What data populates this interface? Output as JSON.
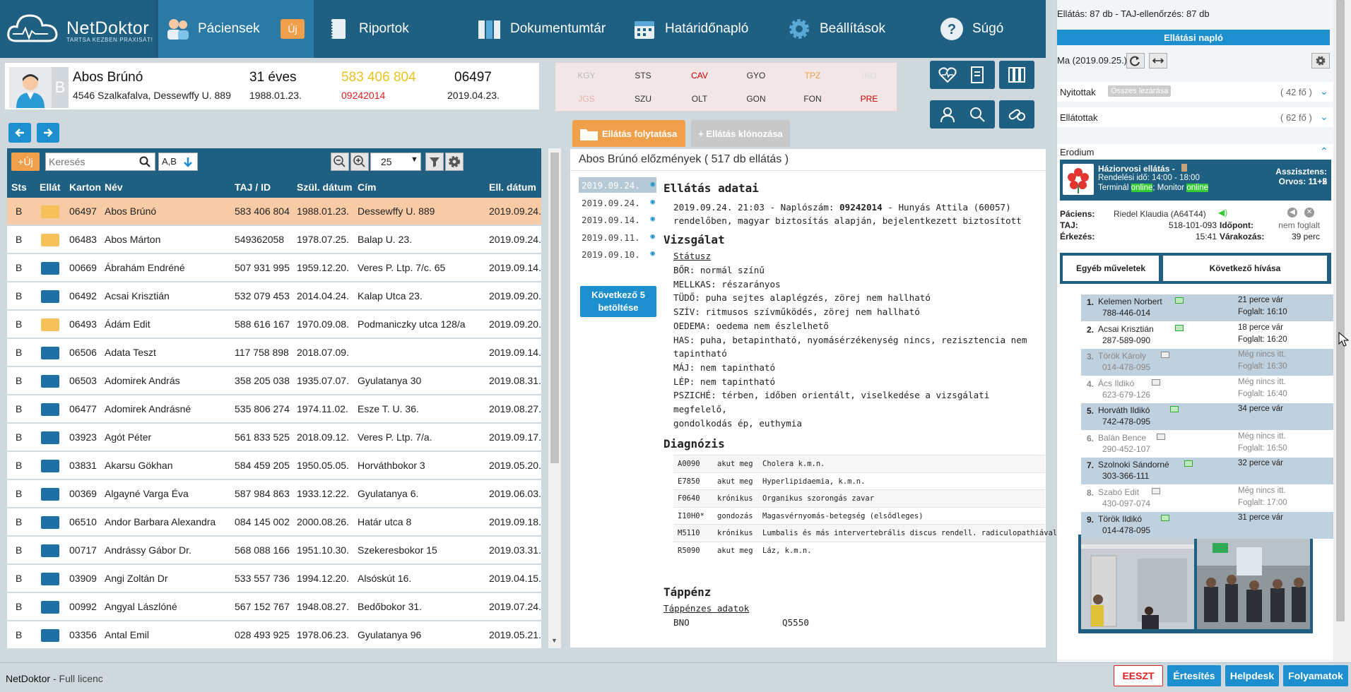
{
  "nav": {
    "logo_name": "NetDoktor",
    "logo_tagline": "TARTSA KEZBEN PRAXISÁT!",
    "patients": "Páciensek",
    "new_badge": "Új",
    "reports": "Riportok",
    "documents": "Dokumentumtár",
    "deadlines": "Határidőnapló",
    "settings": "Beállítások",
    "help": "Súgó"
  },
  "patient": {
    "name": "Abos Brúnó",
    "address": "4546 Szalkafalva, Dessewffy U. 889",
    "age": "31 éves",
    "dob": "1988.01.23.",
    "taj": "583 406 804",
    "log_no": "09242014",
    "card": "06497",
    "card_date": "2019.04.23.",
    "status": "B"
  },
  "flags": {
    "row1": [
      "KGY",
      "STS",
      "CAV",
      "GYO",
      "TPZ",
      "IND"
    ],
    "row2": [
      "JGS",
      "SZU",
      "OLT",
      "GON",
      "FON",
      "PRE"
    ],
    "colors1": [
      "#bbbbbb",
      "#333333",
      "#cc0000",
      "#333333",
      "#f0a04b",
      "#dddddd"
    ],
    "colors2": [
      "#e6b0b0",
      "#333333",
      "#333333",
      "#333333",
      "#333333",
      "#cc0000"
    ]
  },
  "list": {
    "new_btn": "+Új",
    "search_placeholder": "Keresés",
    "sort_label": "A,B",
    "page_size": "25",
    "headers": [
      "Sts",
      "Ellát",
      "Karton",
      "Név",
      "TAJ / ID",
      "Szül. dátum",
      "Cím",
      "Ell. dátum"
    ],
    "rows": [
      {
        "sts": "B",
        "folder": "open",
        "karton": "06497",
        "name": "Abos Brúnó",
        "taj": "583 406 804",
        "dob": "1988.01.23.",
        "addr": "Dessewffy U. 889",
        "date": "2019.09.24."
      },
      {
        "sts": "B",
        "folder": "open",
        "karton": "06483",
        "name": "Abos Márton",
        "taj": "549362058",
        "dob": "1978.07.25.",
        "addr": "Balap U. 23.",
        "date": "2019.09.24."
      },
      {
        "sts": "B",
        "folder": "closed",
        "karton": "00669",
        "name": "Ábrahám Endréné",
        "taj": "507 931 995",
        "dob": "1959.12.20.",
        "addr": "Veres P. Ltp. 7/c. 65",
        "date": "2019.09.14."
      },
      {
        "sts": "B",
        "folder": "closed",
        "karton": "06492",
        "name": "Acsai Krisztián",
        "taj": "532 079 453",
        "dob": "2014.04.24.",
        "addr": "Kalap Utca 23.",
        "date": "2019.09.20."
      },
      {
        "sts": "B",
        "folder": "open",
        "karton": "06493",
        "name": "Ádám Edit",
        "taj": "588 616 167",
        "dob": "1970.09.08.",
        "addr": "Podmaniczky utca 128/a",
        "date": "2019.09.20."
      },
      {
        "sts": "B",
        "folder": "closed",
        "karton": "06506",
        "name": "Adata Teszt",
        "taj": "117 758 898",
        "dob": "2018.07.09.",
        "addr": "",
        "date": "2019.09.14."
      },
      {
        "sts": "B",
        "folder": "closed",
        "karton": "06503",
        "name": "Adomirek András",
        "taj": "358 205 038",
        "dob": "1935.07.07.",
        "addr": "Gyulatanya 30",
        "date": "2019.08.31."
      },
      {
        "sts": "B",
        "folder": "closed",
        "karton": "06477",
        "name": "Adomirek Andrásné",
        "taj": "535 806 274",
        "dob": "1974.11.02.",
        "addr": "Esze T. U. 36.",
        "date": "2019.08.27."
      },
      {
        "sts": "B",
        "folder": "closed",
        "karton": "03923",
        "name": "Agót Péter",
        "taj": "561 833 525",
        "dob": "2018.09.12.",
        "addr": "Veres P. Ltp. 7/a.",
        "date": "2019.09.17."
      },
      {
        "sts": "B",
        "folder": "closed",
        "karton": "03831",
        "name": "Akarsu Gökhan",
        "taj": "584 459 205",
        "dob": "1950.05.05.",
        "addr": "Horváthbokor 3",
        "date": "2019.05.20."
      },
      {
        "sts": "B",
        "folder": "closed",
        "karton": "00369",
        "name": "Algayné Varga Éva",
        "taj": "587 984 863",
        "dob": "1933.12.22.",
        "addr": "Gyulatanya 6.",
        "date": "2019.06.03."
      },
      {
        "sts": "B",
        "folder": "closed",
        "karton": "06510",
        "name": "Andor Barbara Alexandra",
        "taj": "084 145 002",
        "dob": "2000.08.26.",
        "addr": "Határ utca 8",
        "date": "2019.09.18."
      },
      {
        "sts": "B",
        "folder": "closed",
        "karton": "00717",
        "name": "Andrássy Gábor Dr.",
        "taj": "568 088 166",
        "dob": "1951.10.30.",
        "addr": "Szekeresbokor 15",
        "date": "2019.03.31."
      },
      {
        "sts": "B",
        "folder": "closed",
        "karton": "03909",
        "name": "Angi Zoltán Dr",
        "taj": "533 557 736",
        "dob": "1994.12.20.",
        "addr": "Alsóskút 16.",
        "date": "2019.04.15."
      },
      {
        "sts": "B",
        "folder": "closed",
        "karton": "00992",
        "name": "Angyal Lászlóné",
        "taj": "567 152 767",
        "dob": "1948.08.27.",
        "addr": "Bedőbokor 31.",
        "date": "2019.07.24."
      },
      {
        "sts": "B",
        "folder": "closed",
        "karton": "03356",
        "name": "Antal Emil",
        "taj": "028 493 925",
        "dob": "1978.06.23.",
        "addr": "Gyulatanya 96",
        "date": "2019.05.21."
      }
    ]
  },
  "tabs": {
    "continue": "Ellátás folytatása",
    "clone": "+ Ellátás klónozása"
  },
  "history": {
    "title": "Abos Brúnó előzmények ( 517 db ellátás )",
    "dates": [
      "2019.09.24.",
      "2019.09.24.",
      "2019.09.14.",
      "2019.09.11.",
      "2019.09.10."
    ],
    "more_btn_1": "Következő 5",
    "more_btn_2": "betöltése"
  },
  "record": {
    "h_data": "Ellátás adatai",
    "line1_a": "2019.09.24. 21:03 - Naplószám: ",
    "line1_b": "09242014",
    "line1_c": " - Hunyás Attila (60057)",
    "line2": "rendelőben, magyar biztosítás alapján, bejelentkezett biztosított",
    "h_exam": "Vizsgálat",
    "status_link": "Státusz",
    "exam_lines": [
      "BŐR: normál színű",
      "MELLKAS: részarányos",
      "TÜDŐ: puha sejtes alaplégzés, zörej nem hallható",
      "SZÍV: ritmusos szívműködés, zörej nem hallható",
      "OEDEMA: oedema nem észlelhető",
      "HAS: puha, betapintható, nyomásérzékenység nincs, rezisztencia nem",
      "tapintható",
      "MÁJ: nem tapintható",
      "LÉP: nem tapintható",
      "PSZICHÉ: térben, időben orientált, viselkedése a vizsgálati megfelelő,",
      "gondolkodás ép, euthymia"
    ],
    "h_diag": "Diagnózis",
    "diagnoses": [
      {
        "code": "A0090",
        "type": "akut meg",
        "text": "Cholera k.m.n."
      },
      {
        "code": "E7850",
        "type": "akut meg",
        "text": "Hyperlipidaemia, k.m.n."
      },
      {
        "code": "F0640",
        "type": "krónikus",
        "text": "Organikus szorongás zavar"
      },
      {
        "code": "I10H0*",
        "type": "gondozás",
        "text": "Magasvérnyomás-betegség (elsődleges)"
      },
      {
        "code": "M5110",
        "type": "krónikus",
        "text": "Lumbalis és más intervertebrális discus rendell. radiculopathiával"
      },
      {
        "code": "R5090",
        "type": "akut meg",
        "text": "Láz, k.m.n."
      }
    ],
    "h_sick": "Táppénz",
    "sick_link": "Táppénzes adatok",
    "bno_label": "BNO",
    "bno_value": "Q5550"
  },
  "rpanel": {
    "summary": "Ellátás: 87 db - TAJ-ellenőrzés: 87 db",
    "log_btn": "Ellátási napló",
    "today": "Ma (2019.09.25.)",
    "open_label": "Nyitottak",
    "close_all": "Összes lezárása",
    "open_count": "( 42 fő )",
    "served_label": "Ellátottak",
    "served_count": "( 62 fő )",
    "erodium": "Erodium",
    "clinic_title": "Háziorvosi ellátás -",
    "hours": "Rendelési idő: 14:00 - 18:00",
    "terminal_label": "Terminál",
    "terminal_status": "online",
    "monitor_label": "; Monitor",
    "monitor_status": "online",
    "assistants": "Asszisztens: 1+2",
    "doctors": "Orvos: 11+5",
    "patient_label": "Páciens:",
    "patient_value": "Riedel Klaudia (A64T44)",
    "taj_label": "TAJ:",
    "taj_value": "518-101-093",
    "appt_label": "Időpont:",
    "appt_value": "nem foglalt",
    "arrive_label": "Érkezés:",
    "arrive_value": "15:41",
    "wait_label": "Várakozás:",
    "wait_value": "39 perc",
    "other_btn": "Egyéb műveletek",
    "next_btn": "Következő hívása",
    "queue": [
      {
        "n": "1.",
        "name": "Kelemen Norbert",
        "phone": "788-446-014",
        "s1": "21 perce vár",
        "s2": "Foglalt: 16:10",
        "active": true
      },
      {
        "n": "2.",
        "name": "Acsai Krisztián",
        "phone": "287-589-090",
        "s1": "18 perce vár",
        "s2": "Foglalt: 16:20",
        "active": true
      },
      {
        "n": "3.",
        "name": "Török Károly",
        "phone": "014-478-095",
        "s1": "Még nincs itt.",
        "s2": "Foglalt: 16:30",
        "active": false
      },
      {
        "n": "4.",
        "name": "Ács Ildikó",
        "phone": "623-679-126",
        "s1": "Még nincs itt.",
        "s2": "Foglalt: 16:40",
        "active": false
      },
      {
        "n": "5.",
        "name": "Horváth Ildikó",
        "phone": "742-478-095",
        "s1": "34 perce vár",
        "s2": "",
        "active": true
      },
      {
        "n": "6.",
        "name": "Balán Bence",
        "phone": "290-452-107",
        "s1": "Még nincs itt.",
        "s2": "Foglalt: 16:50",
        "active": false
      },
      {
        "n": "7.",
        "name": "Szolnoki Sándorné",
        "phone": "303-366-111",
        "s1": "32 perce vár",
        "s2": "",
        "active": true
      },
      {
        "n": "8.",
        "name": "Szabó Edit",
        "phone": "430-097-074",
        "s1": "Még nincs itt.",
        "s2": "Foglalt: 17:00",
        "active": false
      },
      {
        "n": "9.",
        "name": "Török Ildikó",
        "phone": "014-478-095",
        "s1": "31 perce vár",
        "s2": "",
        "active": true
      }
    ]
  },
  "footer": {
    "app": "NetDoktor",
    "license": " - Full licenc",
    "eeszt": "EESZT",
    "notif": "Értesítés",
    "helpdesk": "Helpdesk",
    "processes": "Folyamatok"
  }
}
